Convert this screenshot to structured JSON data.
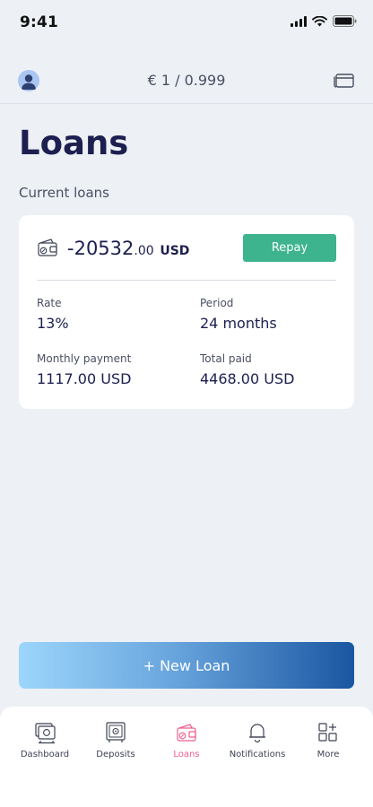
{
  "status_bar": {
    "time": "9:41"
  },
  "header": {
    "exchange_rate": "€ 1 / 0.999"
  },
  "page": {
    "title": "Loans",
    "section_label": "Current loans"
  },
  "loan": {
    "amount_main": "-20532",
    "amount_decimals": ".00",
    "currency": "USD",
    "repay_label": "Repay",
    "rate_label": "Rate",
    "rate_value": "13%",
    "period_label": "Period",
    "period_value": "24 months",
    "monthly_label": "Monthly payment",
    "monthly_value": "1117.00 USD",
    "total_label": "Total paid",
    "total_value": "4468.00 USD"
  },
  "actions": {
    "new_loan_label": "+ New Loan"
  },
  "nav": {
    "items": [
      {
        "label": "Dashboard",
        "icon": "dashboard-icon"
      },
      {
        "label": "Deposits",
        "icon": "safe-icon"
      },
      {
        "label": "Loans",
        "icon": "wallet-icon",
        "active": true
      },
      {
        "label": "Notifications",
        "icon": "bell-icon"
      },
      {
        "label": "More",
        "icon": "grid-plus-icon"
      }
    ]
  },
  "colors": {
    "background": "#edf0f4",
    "primary_text": "#1c1f4f",
    "repay_green": "#3db38e",
    "active_nav_pink": "#ef5d8c",
    "gradient_start": "#9cd6fb",
    "gradient_end": "#1a56a1"
  }
}
